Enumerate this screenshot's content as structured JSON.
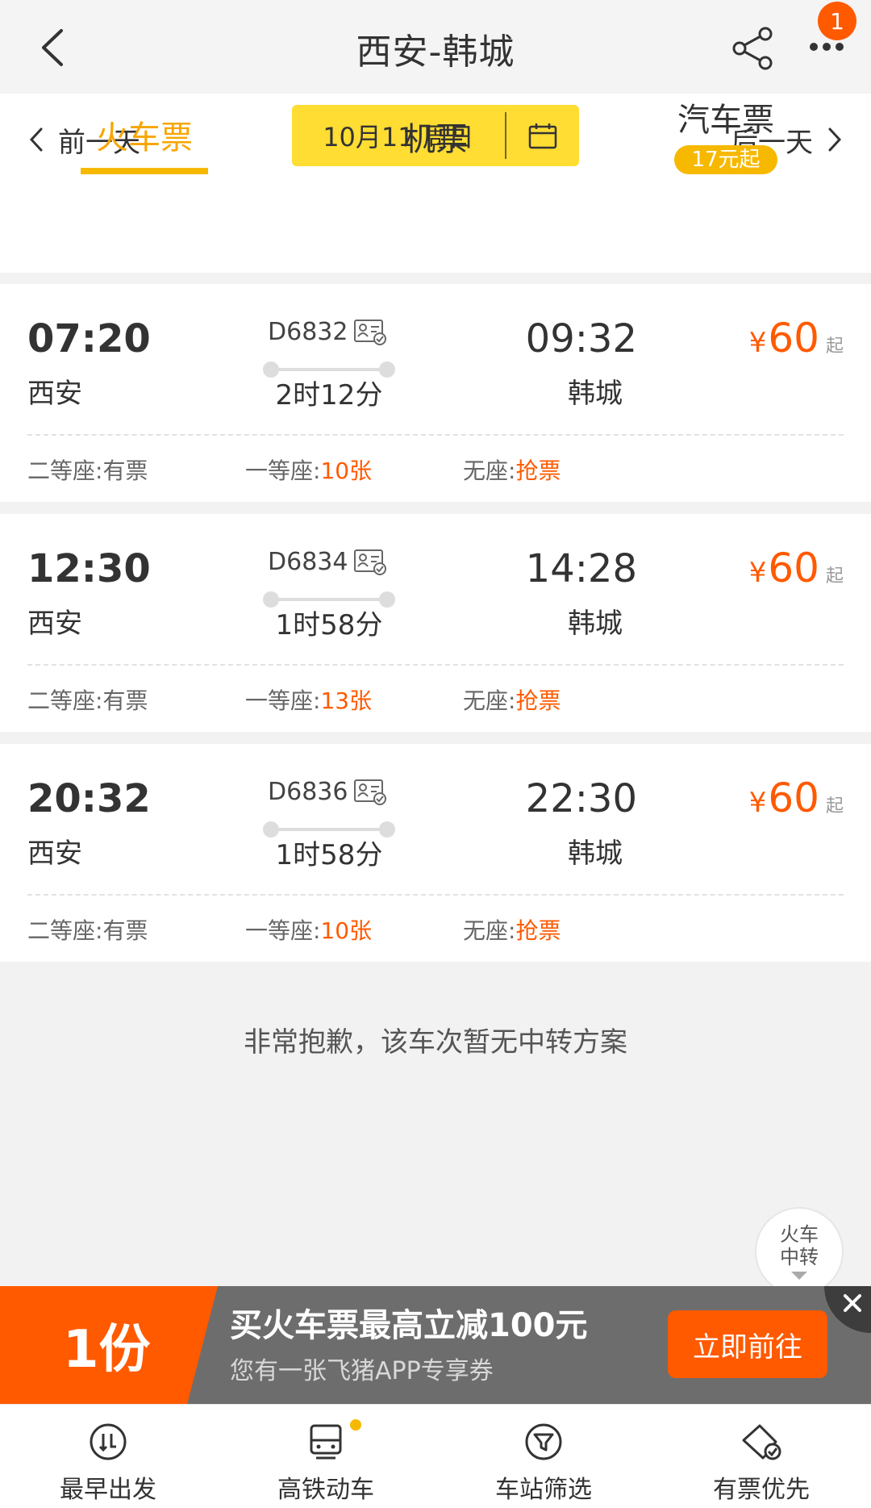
{
  "header": {
    "title": "西安-韩城",
    "notification_count": "1"
  },
  "date_bar": {
    "prev_label": "前一天",
    "next_label": "后一天",
    "date_label": "10月11 周日"
  },
  "mode_tabs": [
    {
      "label": "火车票",
      "active": true
    },
    {
      "label": "机票",
      "active": false
    },
    {
      "label": "汽车票",
      "active": false,
      "badge": "17元起"
    }
  ],
  "trains": [
    {
      "dep_time": "07:20",
      "dep_station": "西安",
      "train_no": "D6832",
      "duration": "2时12分",
      "arr_time": "09:32",
      "arr_station": "韩城",
      "price_symbol": "¥",
      "price": "60",
      "price_suffix": "起",
      "seats": [
        {
          "label": "二等座:",
          "value": "有票",
          "hot": false
        },
        {
          "label": "一等座:",
          "value": "10张",
          "hot": true
        },
        {
          "label": "无座:",
          "value": "抢票",
          "hot": true
        }
      ]
    },
    {
      "dep_time": "12:30",
      "dep_station": "西安",
      "train_no": "D6834",
      "duration": "1时58分",
      "arr_time": "14:28",
      "arr_station": "韩城",
      "price_symbol": "¥",
      "price": "60",
      "price_suffix": "起",
      "seats": [
        {
          "label": "二等座:",
          "value": "有票",
          "hot": false
        },
        {
          "label": "一等座:",
          "value": "13张",
          "hot": true
        },
        {
          "label": "无座:",
          "value": "抢票",
          "hot": true
        }
      ]
    },
    {
      "dep_time": "20:32",
      "dep_station": "西安",
      "train_no": "D6836",
      "duration": "1时58分",
      "arr_time": "22:30",
      "arr_station": "韩城",
      "price_symbol": "¥",
      "price": "60",
      "price_suffix": "起",
      "seats": [
        {
          "label": "二等座:",
          "value": "有票",
          "hot": false
        },
        {
          "label": "一等座:",
          "value": "10张",
          "hot": true
        },
        {
          "label": "无座:",
          "value": "抢票",
          "hot": true
        }
      ]
    }
  ],
  "notice": "非常抱歉，该车次暂无中转方案",
  "float_button": {
    "line1": "火车",
    "line2": "中转"
  },
  "promo": {
    "left_text": "1份",
    "headline": "买火车票最高立减100元",
    "subline": "您有一张飞猪APP专享券",
    "button": "立即前往"
  },
  "bottom_bar": [
    {
      "label": "最早出发",
      "icon": "earliest-icon"
    },
    {
      "label": "高铁动车",
      "icon": "train-icon"
    },
    {
      "label": "车站筛选",
      "icon": "filter-icon"
    },
    {
      "label": "有票优先",
      "icon": "ticket-icon"
    }
  ],
  "colors": {
    "accent_yellow": "#ffdd33",
    "accent_orange": "#ff5a00",
    "tab_active": "#f7a600"
  }
}
